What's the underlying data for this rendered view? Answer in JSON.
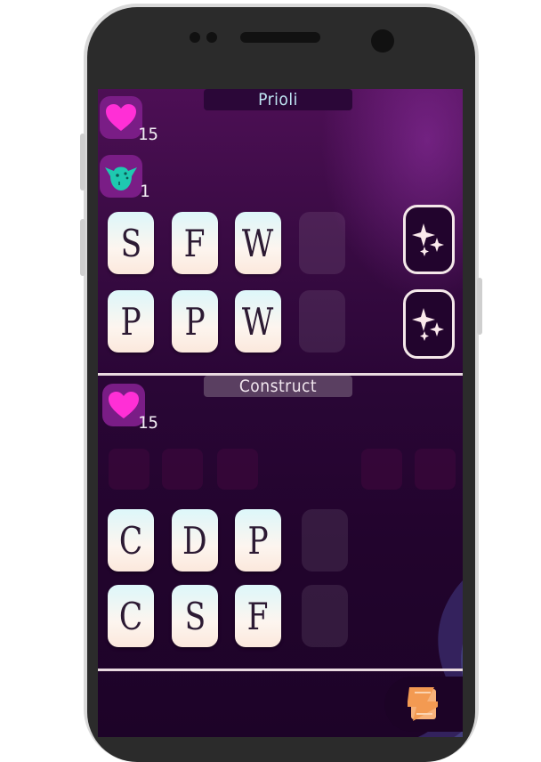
{
  "opponent": {
    "name": "Prioli",
    "health": "15",
    "minions": "1",
    "word_rows": [
      [
        "S",
        "F",
        "W"
      ],
      [
        "P",
        "P",
        "W"
      ]
    ]
  },
  "player": {
    "name": "Construct",
    "health": "15",
    "word_rows": [
      [
        "C",
        "D",
        "P"
      ],
      [
        "C",
        "S",
        "F"
      ]
    ]
  },
  "icons": {
    "heart": "heart-icon",
    "goblin": "goblin-face-icon",
    "sparkle": "sparkle-icon",
    "scroll": "scroll-icon"
  },
  "colors": {
    "heart": "#ff2fd6",
    "goblin": "#1ec9b0",
    "scroll": "#f39a52"
  }
}
